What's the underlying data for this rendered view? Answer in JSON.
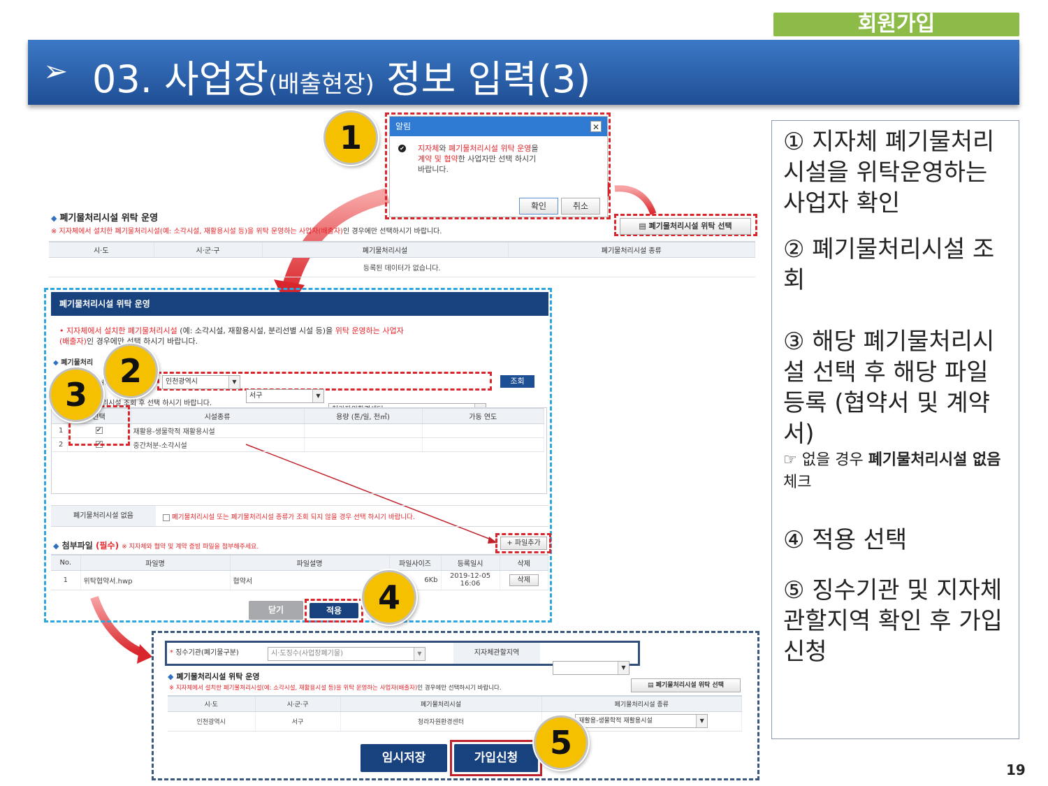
{
  "header": {
    "tag": "회원가입",
    "arrow": "➢",
    "title_main": "03. 사업장",
    "title_paren": "(배출현장)",
    "title_rest": " 정보 입력(3)"
  },
  "markers": [
    "1",
    "2",
    "3",
    "4",
    "5"
  ],
  "dialog": {
    "title": "알림",
    "close": "✕",
    "msg_part1": "지자체",
    "msg_part2": "와 ",
    "msg_part3": "폐기물처리시설 위탁 운영",
    "msg_part4": "을",
    "msg_line2a": "계약 및 협약",
    "msg_line2b": "한 사업자만 선택 하시기",
    "msg_line3": "바랍니다.",
    "ok": "확인",
    "cancel": "취소"
  },
  "top_section": {
    "heading": "폐기물처리시설 위탁 운영",
    "notice_prefix": "※ 지자체에서 설치한 폐기물처리시설",
    "notice_example": "(예: 소각시설, 재활용시설 등)을 위탁 운영하는 사업자(배출자)",
    "notice_suffix": "인 경우에만 선택하시기 바랍니다.",
    "select_button": "폐기물처리시설 위탁 선택",
    "columns": [
      "시·도",
      "시·군·구",
      "폐기물처리시설",
      "폐기물처리시설 종류"
    ],
    "empty": "등록된 데이터가 없습니다."
  },
  "modal": {
    "title": "폐기물처리시설 위탁 운영",
    "notice_a": "• 지자체에서 설치한 폐기물처리시설",
    "notice_b": " (예: 소각시설, 재활용시설, 분리선별 시설 등)을 ",
    "notice_c": "위탁 운영하는 사업자",
    "notice_d": "(배출자)",
    "notice_e": "인 경우에만 선택 하시기 바랍니다.",
    "search_label": "폐기물처리",
    "search_label_tail": "회",
    "row_label": "처리",
    "sido": "인천광역시",
    "sigungu": "서구",
    "facility": "청라자원환경센터",
    "search_button": "조회",
    "hint_head": "리시설 조회 후 선택 하시기 바랍니다.",
    "columns": [
      "선택",
      "시설종류",
      "용량 (톤/일, 천㎥)",
      "가동 연도"
    ],
    "rows": [
      {
        "no": "1",
        "type": "재활용-생물학적 재활용시설"
      },
      {
        "no": "2",
        "type": "중간처분-소각시설"
      }
    ],
    "none_label": "폐기물처리시설 없음",
    "none_text": "폐기물처리시설 또는 폐기물처리시설 종류가 조회 되지 않을 경우 선택 하시기 바랍니다.",
    "attach_heading": "첨부파일",
    "attach_required": "(필수)",
    "attach_note": "※ 지자체와 협약 및 계약 증빙 파일을 첨부해주세요.",
    "add_file": "+ 파일추가",
    "file_columns": [
      "No.",
      "파일명",
      "파일설명",
      "파일사이즈",
      "등록일시",
      "삭제"
    ],
    "file_row": {
      "no": "1",
      "name": "위탁협약서.hwp",
      "desc": "협약서",
      "size": "6Kb",
      "date": "2019-12-05 16:06",
      "delete": "삭제"
    },
    "close_btn": "닫기",
    "apply_btn": "적용"
  },
  "bottom_form": {
    "agency_label": "징수기관(폐기물구분)",
    "agency_value": "시·도징수(사업장폐기물)",
    "region_label": "지자체관할지역",
    "heading": "폐기물처리시설 위탁 운영",
    "notice_prefix": "※ 지자체에서 설치한 폐기물처리시설",
    "notice_example": "(예: 소각시설, 재활용시설 등)을 위탁 운영하는 사업자(배출자)",
    "notice_suffix": "인 경우에만 선택하시기 바랍니다.",
    "select_button": "폐기물처리시설 위탁 선택",
    "columns": [
      "시·도",
      "시·군·구",
      "폐기물처리시설",
      "폐기물처리시설 종류"
    ],
    "row": {
      "sido": "인천광역시",
      "sigungu": "서구",
      "facility": "청라자원환경센터",
      "type": "재활용-생물학적 재활용시설"
    },
    "save_btn": "임시저장",
    "join_btn": "가입신청"
  },
  "notes": {
    "n1": "① 지자체 폐기물처리시설을 위탁운영하는 사업자 확인",
    "n2": "② 폐기물처리시설 조회",
    "n3": "③ 해당 폐기물처리시설 선택 후 해당 파일 등록 (협약서 및 계약서)",
    "n3_sub_icon": "☞",
    "n3_sub_a": " 없을 경우 ",
    "n3_sub_b": "폐기물처리시설 없음",
    "n3_sub_c": " 체크",
    "n4": "④ 적용 선택",
    "n5": "⑤ 징수기관 및 지자체 관할지역 확인 후 가입신청"
  },
  "page_number": "19",
  "colors": {
    "accent": "#2f6fc1",
    "tag": "#8dbb47",
    "marker": "#f5c000",
    "highlight": "#d9262c"
  }
}
